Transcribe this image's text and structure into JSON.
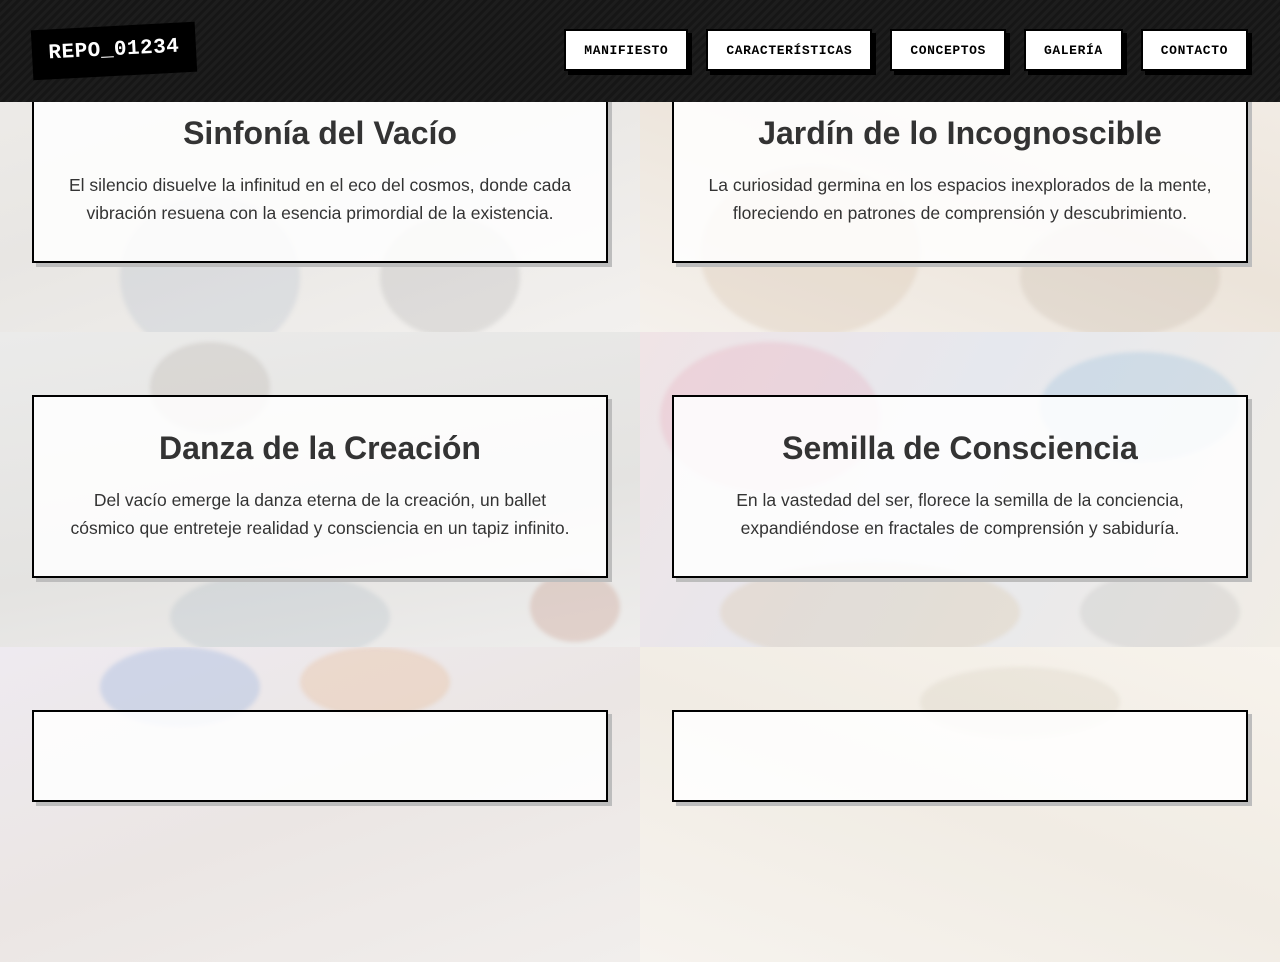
{
  "header": {
    "logo": "REPO_01234",
    "nav": [
      {
        "label": "MANIFIESTO"
      },
      {
        "label": "CARACTERÍSTICAS"
      },
      {
        "label": "CONCEPTOS"
      },
      {
        "label": "GALERÍA"
      },
      {
        "label": "CONTACTO"
      }
    ]
  },
  "cards": [
    {
      "title": "Sinfonía del Vacío",
      "text": "El silencio disuelve la infinitud en el eco del cosmos, donde cada vibración resuena con la esencia primordial de la existencia."
    },
    {
      "title": "Jardín de lo Incognoscible",
      "text": "La curiosidad germina en los espacios inexplorados de la mente, floreciendo en patrones de comprensión y descubrimiento."
    },
    {
      "title": "Danza de la Creación",
      "text": "Del vacío emerge la danza eterna de la creación, un ballet cósmico que entreteje realidad y consciencia en un tapiz infinito."
    },
    {
      "title": "Semilla de Consciencia",
      "text": "En la vastedad del ser, florece la semilla de la conciencia, expandiéndose en fractales de comprensión y sabiduría."
    },
    {
      "title": "",
      "text": ""
    },
    {
      "title": "",
      "text": ""
    }
  ]
}
